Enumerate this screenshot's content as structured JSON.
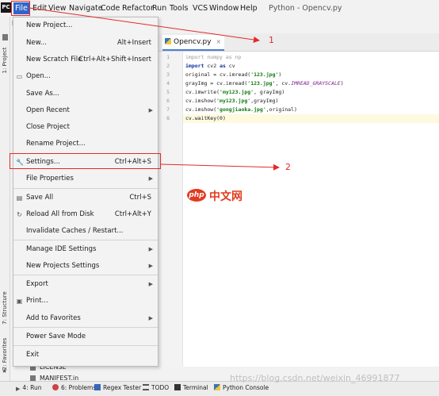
{
  "menubar": {
    "logo_text": "PC",
    "items": [
      "File",
      "Edit",
      "View",
      "Navigate",
      "Code",
      "Refactor",
      "Run",
      "Tools",
      "VCS",
      "Window",
      "Help"
    ],
    "window_title": "Python - Opencv.py"
  },
  "left_strip": {
    "tabs": [
      "1: Project",
      "7: Structure",
      "2: Favorites"
    ],
    "panel_header": "P"
  },
  "project_tree": {
    "rows": [
      "LICENSE",
      "MANIFEST.in"
    ]
  },
  "file_menu": {
    "items": [
      {
        "label": "New Project...",
        "shortcut": "",
        "submenu": false,
        "icon": ""
      },
      {
        "label": "New...",
        "shortcut": "Alt+Insert",
        "submenu": false,
        "icon": ""
      },
      {
        "label": "New Scratch File",
        "shortcut": "Ctrl+Alt+Shift+Insert",
        "submenu": false,
        "icon": ""
      },
      {
        "label": "Open...",
        "shortcut": "",
        "submenu": false,
        "icon": "folder-icon"
      },
      {
        "label": "Save As...",
        "shortcut": "",
        "submenu": false,
        "icon": ""
      },
      {
        "label": "Open Recent",
        "shortcut": "",
        "submenu": true,
        "icon": ""
      },
      {
        "label": "Close Project",
        "shortcut": "",
        "submenu": false,
        "icon": ""
      },
      {
        "label": "Rename Project...",
        "shortcut": "",
        "submenu": false,
        "icon": ""
      },
      {
        "label": "Settings...",
        "shortcut": "Ctrl+Alt+S",
        "submenu": false,
        "icon": "wrench-icon"
      },
      {
        "label": "File Properties",
        "shortcut": "",
        "submenu": true,
        "icon": ""
      },
      {
        "label": "Save All",
        "shortcut": "Ctrl+S",
        "submenu": false,
        "icon": "save-icon"
      },
      {
        "label": "Reload All from Disk",
        "shortcut": "Ctrl+Alt+Y",
        "submenu": false,
        "icon": "reload-icon"
      },
      {
        "label": "Invalidate Caches / Restart...",
        "shortcut": "",
        "submenu": false,
        "icon": ""
      },
      {
        "label": "Manage IDE Settings",
        "shortcut": "",
        "submenu": true,
        "icon": ""
      },
      {
        "label": "New Projects Settings",
        "shortcut": "",
        "submenu": true,
        "icon": ""
      },
      {
        "label": "Export",
        "shortcut": "",
        "submenu": true,
        "icon": ""
      },
      {
        "label": "Print...",
        "shortcut": "",
        "submenu": false,
        "icon": "print-icon"
      },
      {
        "label": "Add to Favorites",
        "shortcut": "",
        "submenu": true,
        "icon": ""
      },
      {
        "label": "Power Save Mode",
        "shortcut": "",
        "submenu": false,
        "icon": ""
      },
      {
        "label": "Exit",
        "shortcut": "",
        "submenu": false,
        "icon": ""
      }
    ]
  },
  "editor": {
    "tab_label": "Opencv.py",
    "tab_close": "×",
    "line_numbers": [
      "1",
      "2",
      "3",
      "4",
      "5",
      "6",
      "7",
      "8"
    ],
    "lines": [
      "import numpy as np",
      "import cv2 as cv",
      "original = cv.imread('123.jpg')",
      "grayImg = cv.imread('123.jpg', cv.IMREAD_GRAYSCALE)",
      "cv.imwrite('my123.jpg', grayImg)",
      "cv.imshow('my123.jpg',grayImg)",
      "cv.imshow('gongjiaoka.jpg',original)",
      "cv.waitKey(0)"
    ]
  },
  "annotations": {
    "label_1": "1",
    "label_2": "2",
    "color": "#e32a2a"
  },
  "watermark": {
    "logo": "php",
    "text": "中文网",
    "url": "https://blog.csdn.net/weixin_46991877"
  },
  "bottom_bar": {
    "items": [
      "4: Run",
      "6: Problems",
      "Regex Tester",
      "TODO",
      "Terminal",
      "Python Console"
    ]
  },
  "colors": {
    "menu_highlight": "#2f65ca",
    "annotation_red": "#e32a2a",
    "keyword_blue": "#0b2d9c",
    "string_green": "#117a11"
  }
}
